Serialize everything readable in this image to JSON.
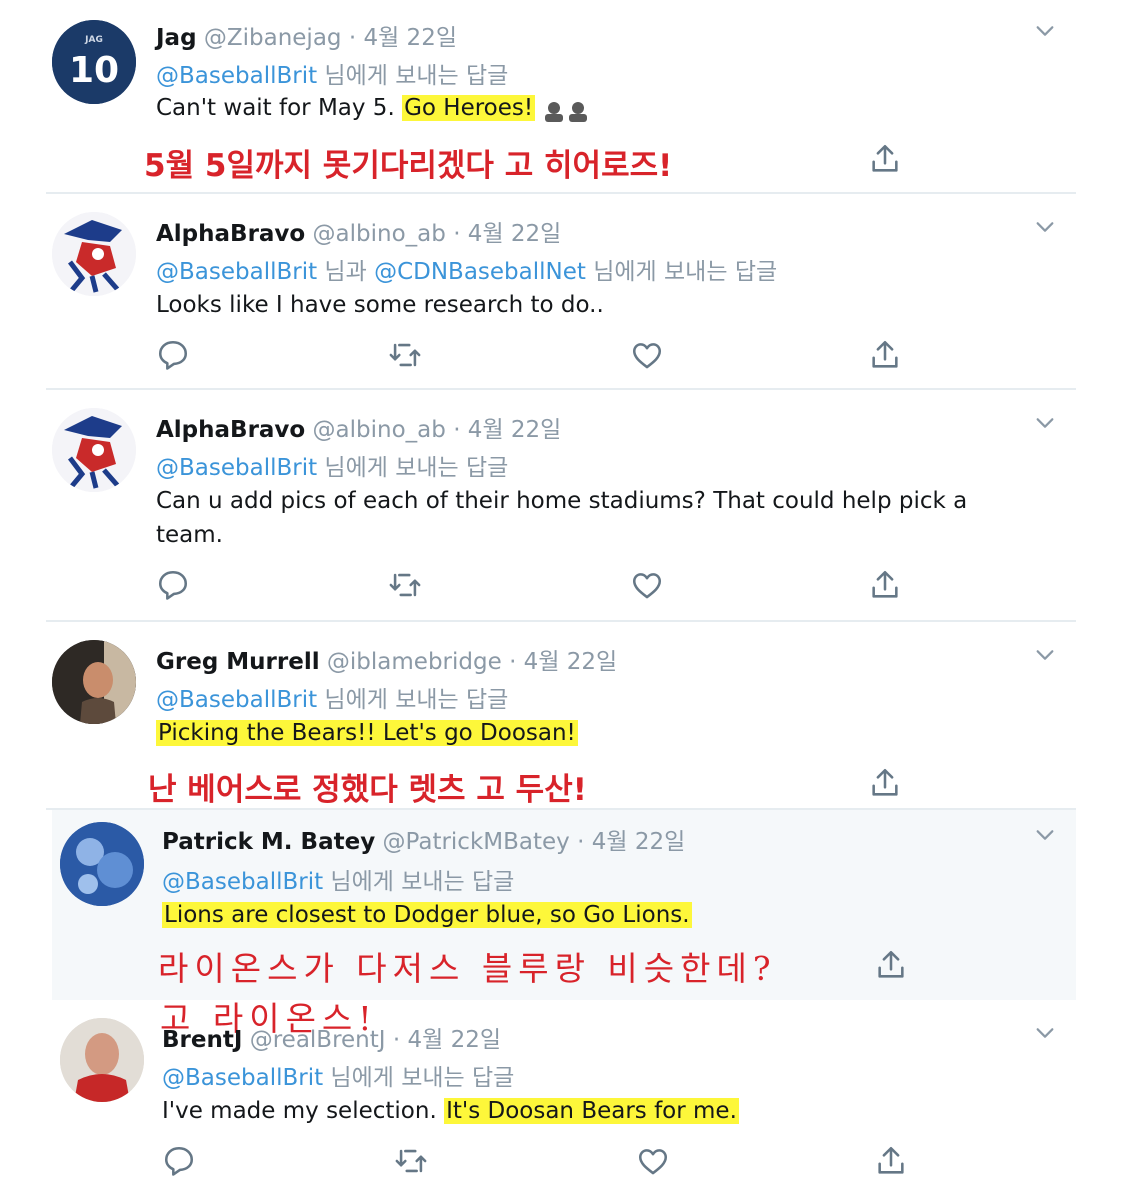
{
  "tweets": [
    {
      "name": "Jag",
      "handle": "@Zibanejag",
      "date": "· 4월 22일",
      "reply_mention": "@BaseballBrit",
      "reply_suffix": " 님에게 보내는 답글",
      "text_plain": "Can't wait for May 5. ",
      "text_hl": "Go Heroes!",
      "avatar_jersey_label": "JAG",
      "avatar_number": "10",
      "annotation": "5월 5일까지 못기다리겠다 고 히어로즈!"
    },
    {
      "name": "AlphaBravo",
      "handle": "@albino_ab",
      "date": "· 4월 22일",
      "reply_mention": "@BaseballBrit",
      "reply_mid": " 님과 ",
      "reply_mention2": "@CDNBaseballNet",
      "reply_suffix": " 님에게 보내는 답글",
      "text_plain": "Looks like I have some research to do.."
    },
    {
      "name": "AlphaBravo",
      "handle": "@albino_ab",
      "date": "· 4월 22일",
      "reply_mention": "@BaseballBrit",
      "reply_suffix": " 님에게 보내는 답글",
      "text_line1": "Can u add pics of each of their home stadiums? That could help pick a",
      "text_line2": "team."
    },
    {
      "name": "Greg Murrell",
      "handle": "@iblamebridge",
      "date": "· 4월 22일",
      "reply_mention": "@BaseballBrit",
      "reply_suffix": " 님에게 보내는 답글",
      "text_hl": "Picking the Bears!!  Let's go Doosan!",
      "annotation": "난 베어스로 정했다 렛츠 고 두산!"
    },
    {
      "name": "Patrick M. Batey",
      "handle": "@PatrickMBatey",
      "date": "· 4월 22일",
      "reply_mention": "@BaseballBrit",
      "reply_suffix": " 님에게 보내는 답글",
      "text_hl": "Lions are closest to Dodger blue, so Go Lions.",
      "annotation_line1": "라이온스가 다저스 블루랑 비슷한데?",
      "annotation_line2": "고 라이온스!"
    },
    {
      "name": "BrentJ",
      "handle": "@realBrentJ",
      "date": "· 4월 22일",
      "reply_mention": "@BaseballBrit",
      "reply_suffix": " 님에게 보내는 답글",
      "text_plain": "I've made my selection.  ",
      "text_hl": "It's Doosan Bears for me."
    }
  ],
  "icons": [
    "chevron-down-icon",
    "reply-icon",
    "retweet-icon",
    "like-icon",
    "share-icon"
  ],
  "colors": {
    "highlight": "#fdf73a",
    "annotation": "#d8232a",
    "mention": "#3b94d9",
    "muted": "#8b99a6"
  }
}
